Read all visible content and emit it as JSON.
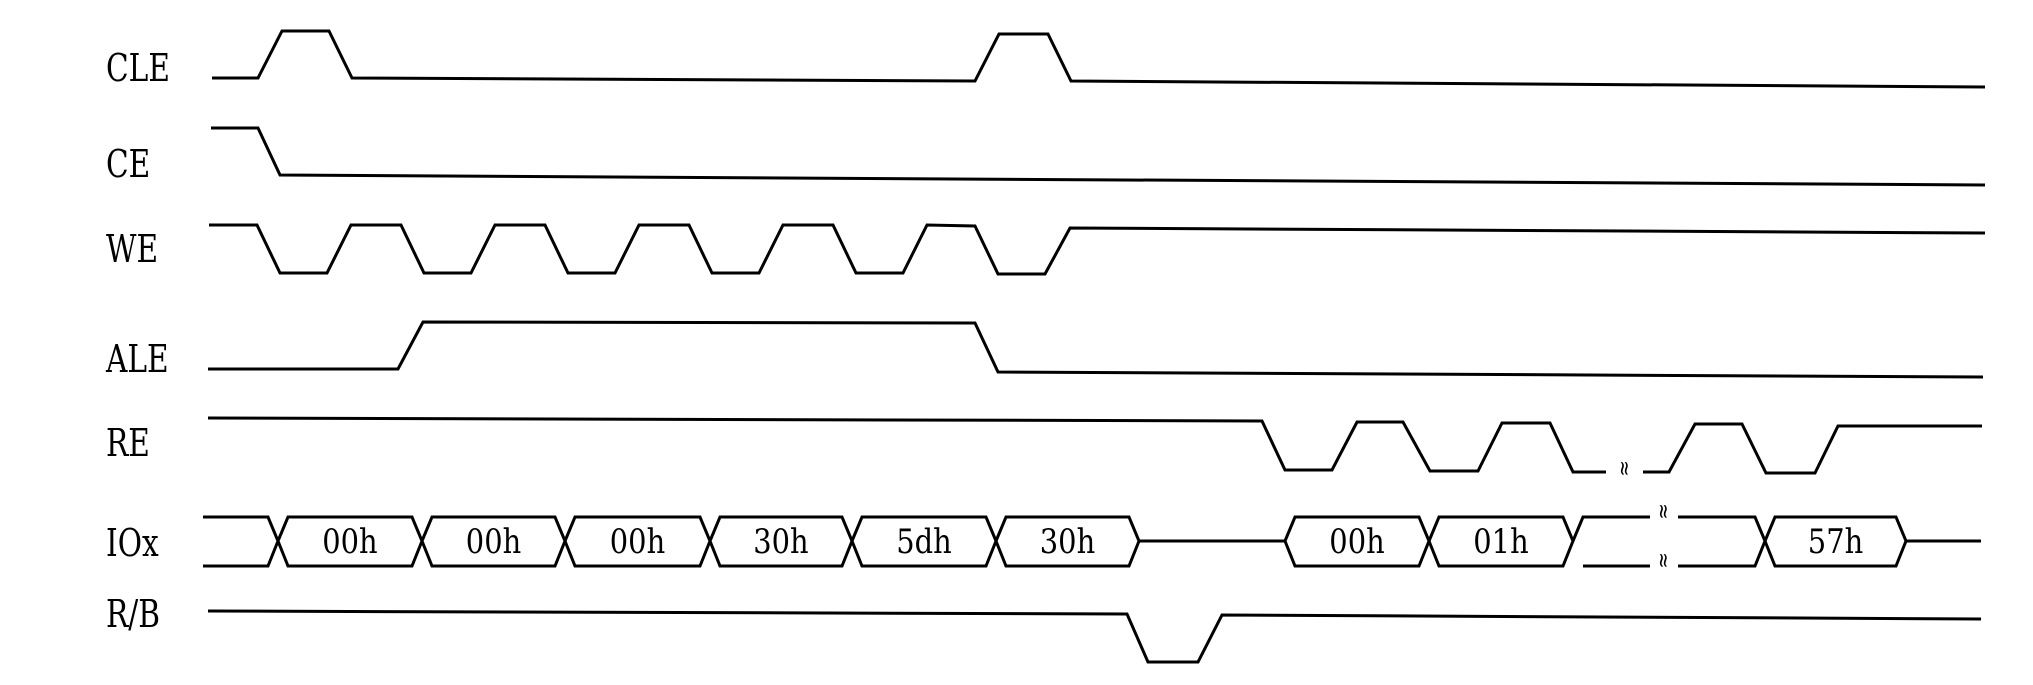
{
  "diagram": {
    "type": "timing-diagram",
    "title": "",
    "signals": [
      {
        "name": "CLE",
        "kind": "digital",
        "edges": [
          {
            "t": "start",
            "level": 0
          },
          {
            "t": "rise",
            "at": 1
          },
          {
            "t": "fall",
            "at": 2
          },
          {
            "t": "rise",
            "at": 11
          },
          {
            "t": "fall",
            "at": 12
          }
        ]
      },
      {
        "name": "CE",
        "kind": "digital",
        "edges": [
          {
            "t": "start",
            "level": 1
          },
          {
            "t": "fall",
            "at": 1
          }
        ]
      },
      {
        "name": "WE",
        "kind": "digital",
        "pulses_low": 6
      },
      {
        "name": "ALE",
        "kind": "digital",
        "edges": [
          {
            "t": "start",
            "level": 0
          },
          {
            "t": "rise",
            "at": 3
          },
          {
            "t": "fall",
            "at": 11
          }
        ]
      },
      {
        "name": "RE",
        "kind": "digital",
        "pulses_low": 5,
        "break_after_pulse": 3
      },
      {
        "name": "IOx",
        "kind": "bus",
        "write_cycles": [
          "00h",
          "00h",
          "00h",
          "30h",
          "5dh",
          "30h"
        ],
        "read_cycles": [
          "00h",
          "01h",
          "",
          "57h"
        ],
        "break_in_read_cycle": 3
      },
      {
        "name": "R/B",
        "kind": "digital",
        "busy_pulses": 1
      }
    ],
    "break_symbol": "≈"
  }
}
